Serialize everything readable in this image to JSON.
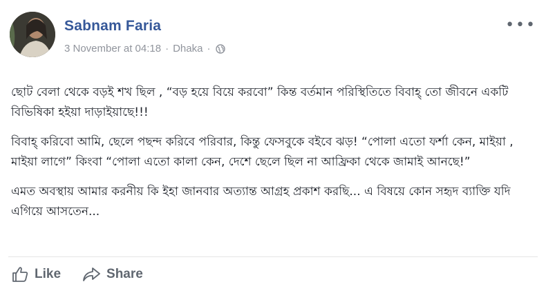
{
  "post": {
    "author": "Sabnam Faria",
    "timestamp": "3 November at 04:18",
    "separator": "·",
    "location": "Dhaka",
    "privacy_icon": "globe-icon",
    "more_icon": "more-options-icon",
    "body": {
      "paragraph_1": "ছোট বেলা থেকে বড়ই শখ ছিল , “বড় হয়ে বিয়ে করবো” কিন্ত বর্তমান পরিস্থিতিতে বিবাহ্ তো জীবনে একটি বিভিষিকা হইয়া দাড়াইয়াছে!!!",
      "paragraph_2": "বিবাহ্ করিবো আমি, ছেলে পছন্দ করিবে পরিবার, কিন্তু ফেসবুকে বইবে ঝড়! “পোলা এতো ফর্শা কেন, মাইয়া , মাইয়া লাগে” কিংবা “পোলা এতো কালা কেন, দেশে ছেলে ছিল না আফ্রিকা থেকে জামাই আনছে!”",
      "paragraph_3": "এমত অবস্থায় আমার করনীয় কি ইহা জানবার অত্যান্ত আগ্রহ প্রকাশ করছি... এ বিষয়ে কোন সহৃদ ব্যাক্তি যদি এগিয়ে আসতেন..."
    },
    "actions": {
      "like_label": "Like",
      "share_label": "Share"
    }
  },
  "colors": {
    "author_link": "#365899",
    "meta_text": "#90949c",
    "body_text": "#1d2129",
    "action_text": "#606770"
  }
}
